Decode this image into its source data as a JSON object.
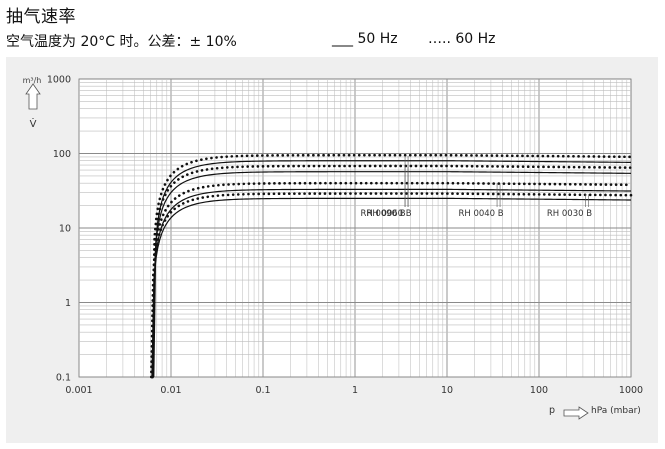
{
  "header": {
    "title": "抽气速率",
    "subtitle": "空气温度为 20°C 时。公差：± 10%",
    "legend_solid": "___ 50 Hz",
    "legend_dotted": "….. 60 Hz"
  },
  "chart_data": {
    "type": "line",
    "ylabel": "m³/h",
    "ylabel_symbol": "V̇",
    "xlabel_p": "p",
    "xlabel_unit": "hPa (mbar)",
    "x_scale": "log",
    "y_scale": "log",
    "xlim": [
      0.001,
      1000
    ],
    "ylim": [
      0.1,
      1000
    ],
    "grid": true,
    "x_ticks": [
      "0.001",
      "0.01",
      "0.1",
      "1",
      "10",
      "100",
      "1000"
    ],
    "y_ticks": [
      "0.1",
      "1",
      "10",
      "100",
      "1000"
    ],
    "series": [
      {
        "name": "RH 0090 B",
        "freq": "50 Hz",
        "style": "solid",
        "plateau": 80,
        "p0": 0.0065
      },
      {
        "name": "RH 0090 B",
        "freq": "60 Hz",
        "style": "dotted",
        "plateau": 95,
        "p0": 0.0063
      },
      {
        "name": "RH 0060 B",
        "freq": "50 Hz",
        "style": "solid",
        "plateau": 57,
        "p0": 0.0064
      },
      {
        "name": "RH 0060 B",
        "freq": "60 Hz",
        "style": "dotted",
        "plateau": 68,
        "p0": 0.0063
      },
      {
        "name": "RH 0040 B",
        "freq": "50 Hz",
        "style": "solid",
        "plateau": 33,
        "p0": 0.0063
      },
      {
        "name": "RH 0040 B",
        "freq": "60 Hz",
        "style": "dotted",
        "plateau": 40,
        "p0": 0.0062
      },
      {
        "name": "RH 0030 B",
        "freq": "50 Hz",
        "style": "solid",
        "plateau": 25,
        "p0": 0.0062
      },
      {
        "name": "RH 0030 B",
        "freq": "60 Hz",
        "style": "dotted",
        "plateau": 29,
        "p0": 0.0061
      }
    ],
    "annotations": [
      {
        "text": "RH 0090 B",
        "p": 3.5
      },
      {
        "text": "RH 0060 B",
        "p": 3.5
      },
      {
        "text": "RH 0040 B",
        "p": 35
      },
      {
        "text": "RH 0030 B",
        "p": 320
      }
    ]
  }
}
